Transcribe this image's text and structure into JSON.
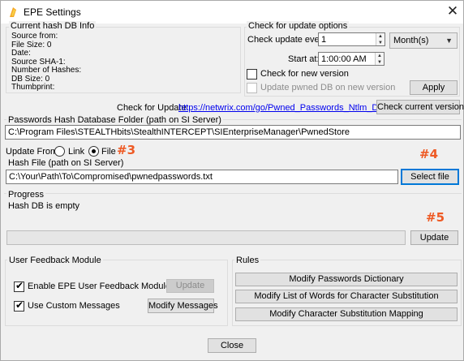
{
  "window": {
    "title": "EPE Settings",
    "close_glyph": "✕"
  },
  "hash_info": {
    "group_label": "Current hash DB Info",
    "lines": [
      "Source from:",
      "File Size: 0",
      "Date:",
      "Source SHA-1:",
      "Number of Hashes:",
      "DB Size: 0",
      "Thumbprint:"
    ]
  },
  "update_options": {
    "group_label": "Check for update options",
    "every_label": "Check update every:",
    "every_value": "1",
    "period_value": "Month(s)",
    "start_label": "Start at:",
    "start_value": "1:00:00 AM",
    "new_version_label": "Check for new version",
    "new_version_checked": false,
    "pwned_label": "Update pwned DB on new version",
    "pwned_enabled": false,
    "apply_label": "Apply"
  },
  "check_update": {
    "label": "Check for Update:",
    "url": "https://netwrix.com/go/Pwned_Passwords_Ntlm_Db",
    "button_label": "Check current version"
  },
  "db_folder": {
    "label": "Passwords Hash Database Folder (path on SI Server)",
    "value": "C:\\Program Files\\STEALTHbits\\StealthINTERCEPT\\SIEnterpriseManager\\PwnedStore"
  },
  "update_from": {
    "label": "Update From:",
    "link_label": "Link",
    "file_label": "File",
    "selected": "File"
  },
  "hash_file": {
    "label": "Hash File (path on SI Server)",
    "value": "C:\\Your\\Path\\To\\Compromised\\pwnedpasswords.txt",
    "select_label": "Select file"
  },
  "progress": {
    "label": "Progress",
    "status": "Hash DB is empty",
    "fill_fraction": 0,
    "update_label": "Update"
  },
  "annotations": {
    "a3": "#3",
    "a4": "#4",
    "a5": "#5"
  },
  "feedback": {
    "group_label": "User Feedback Module",
    "enable_label": "Enable EPE User Feedback Module",
    "enable_checked": true,
    "update_label": "Update",
    "custom_label": "Use Custom Messages",
    "custom_checked": true,
    "modify_label": "Modify Messages"
  },
  "rules": {
    "group_label": "Rules",
    "buttons": [
      "Modify Passwords Dictionary",
      "Modify List of Words for Character Substitution",
      "Modify Character Substitution Mapping"
    ]
  },
  "footer": {
    "close_label": "Close"
  },
  "colors": {
    "accent": "#0078d7",
    "annotation": "#ee5a24",
    "link": "#0000ee"
  }
}
